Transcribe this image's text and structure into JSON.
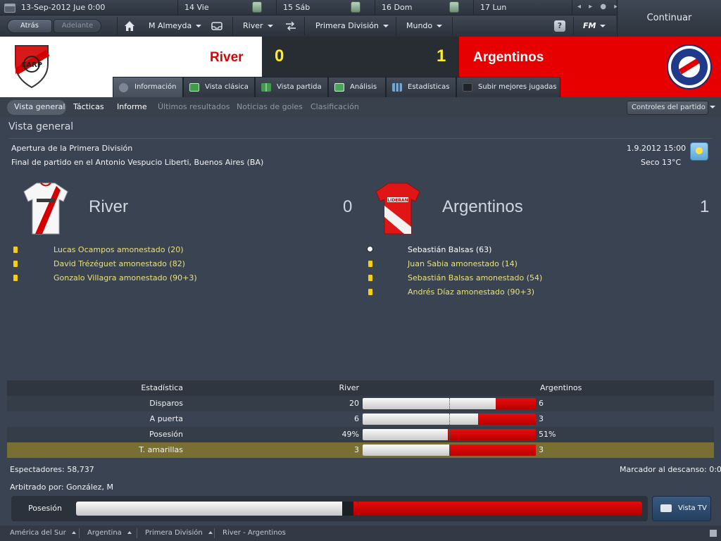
{
  "calendar": {
    "current_date": "13-Sep-2012  Jue  0:00",
    "days": [
      "14  Vie",
      "15  Sáb",
      "16  Dom",
      "17  Lun"
    ]
  },
  "nav": {
    "back": "Atrás",
    "forward": "Adelante",
    "manager": "M Almeyda",
    "club": "River",
    "competition": "Primera División",
    "world": "Mundo",
    "help": "?",
    "fm": "FM",
    "continue": "Continuar"
  },
  "match": {
    "home_team": "River",
    "away_team": "Argentinos",
    "home_score": "0",
    "away_score": "1",
    "home_color": "#e00000",
    "away_color": "#e60000"
  },
  "tabs": [
    {
      "label": "Información",
      "icon": "info-icon"
    },
    {
      "label": "Vista clásica",
      "icon": "pitch-icon"
    },
    {
      "label": "Vista partida",
      "icon": "split-view-icon"
    },
    {
      "label": "Análisis",
      "icon": "analysis-icon"
    },
    {
      "label": "Estadísticas",
      "icon": "stats-icon"
    },
    {
      "label": "Subir mejores jugadas",
      "icon": "camera-icon"
    }
  ],
  "subtabs": [
    "Vista general",
    "Tácticas",
    "Informe",
    "Últimos resultados",
    "Noticias de goles",
    "Clasificación"
  ],
  "match_controls": "Controles del partido",
  "overview": {
    "title": "Vista general",
    "competition": "Apertura de la Primera División",
    "result_line": "Final de partido en el Antonio Vespucio Liberti, Buenos Aires (BA)",
    "datetime": "1.9.2012 15:00",
    "weather": "Seco 13°C"
  },
  "home_events": [
    "Lucas Ocampos amonestado (20)",
    "David Trézéguet amonestado (82)",
    "Gonzalo Villagra amonestado (90+3)"
  ],
  "away_events": [
    {
      "text": "Sebastián Balsas (63)",
      "type": "goal"
    },
    {
      "text": "Juan Sabia amonestado (14)",
      "type": "card"
    },
    {
      "text": "Sebastián Balsas amonestado (54)",
      "type": "card"
    },
    {
      "text": "Andrés Díaz amonestado (90+3)",
      "type": "card"
    }
  ],
  "stats": {
    "header": {
      "label": "Estadística",
      "home": "River",
      "away": "Argentinos"
    },
    "rows": [
      {
        "label": "Disparos",
        "home": "20",
        "away": "6",
        "home_frac": 0.769
      },
      {
        "label": "A puerta",
        "home": "6",
        "away": "3",
        "home_frac": 0.667
      },
      {
        "label": "Posesión",
        "home": "49%",
        "away": "51%",
        "home_frac": 0.49
      },
      {
        "label": "T. amarillas",
        "home": "3",
        "away": "3",
        "home_frac": 0.5
      }
    ]
  },
  "footer": {
    "spectators": "Espectadores: 58,737",
    "referee": "Arbitrado por: González, M",
    "halftime": "Marcador al descanso: 0:0",
    "possession_label": "Posesión",
    "possession_home_frac": 0.49,
    "tv_view": "Vista TV"
  },
  "breadcrumbs": [
    "América del Sur",
    "Argentina",
    "Primera División",
    "River - Argentinos"
  ]
}
